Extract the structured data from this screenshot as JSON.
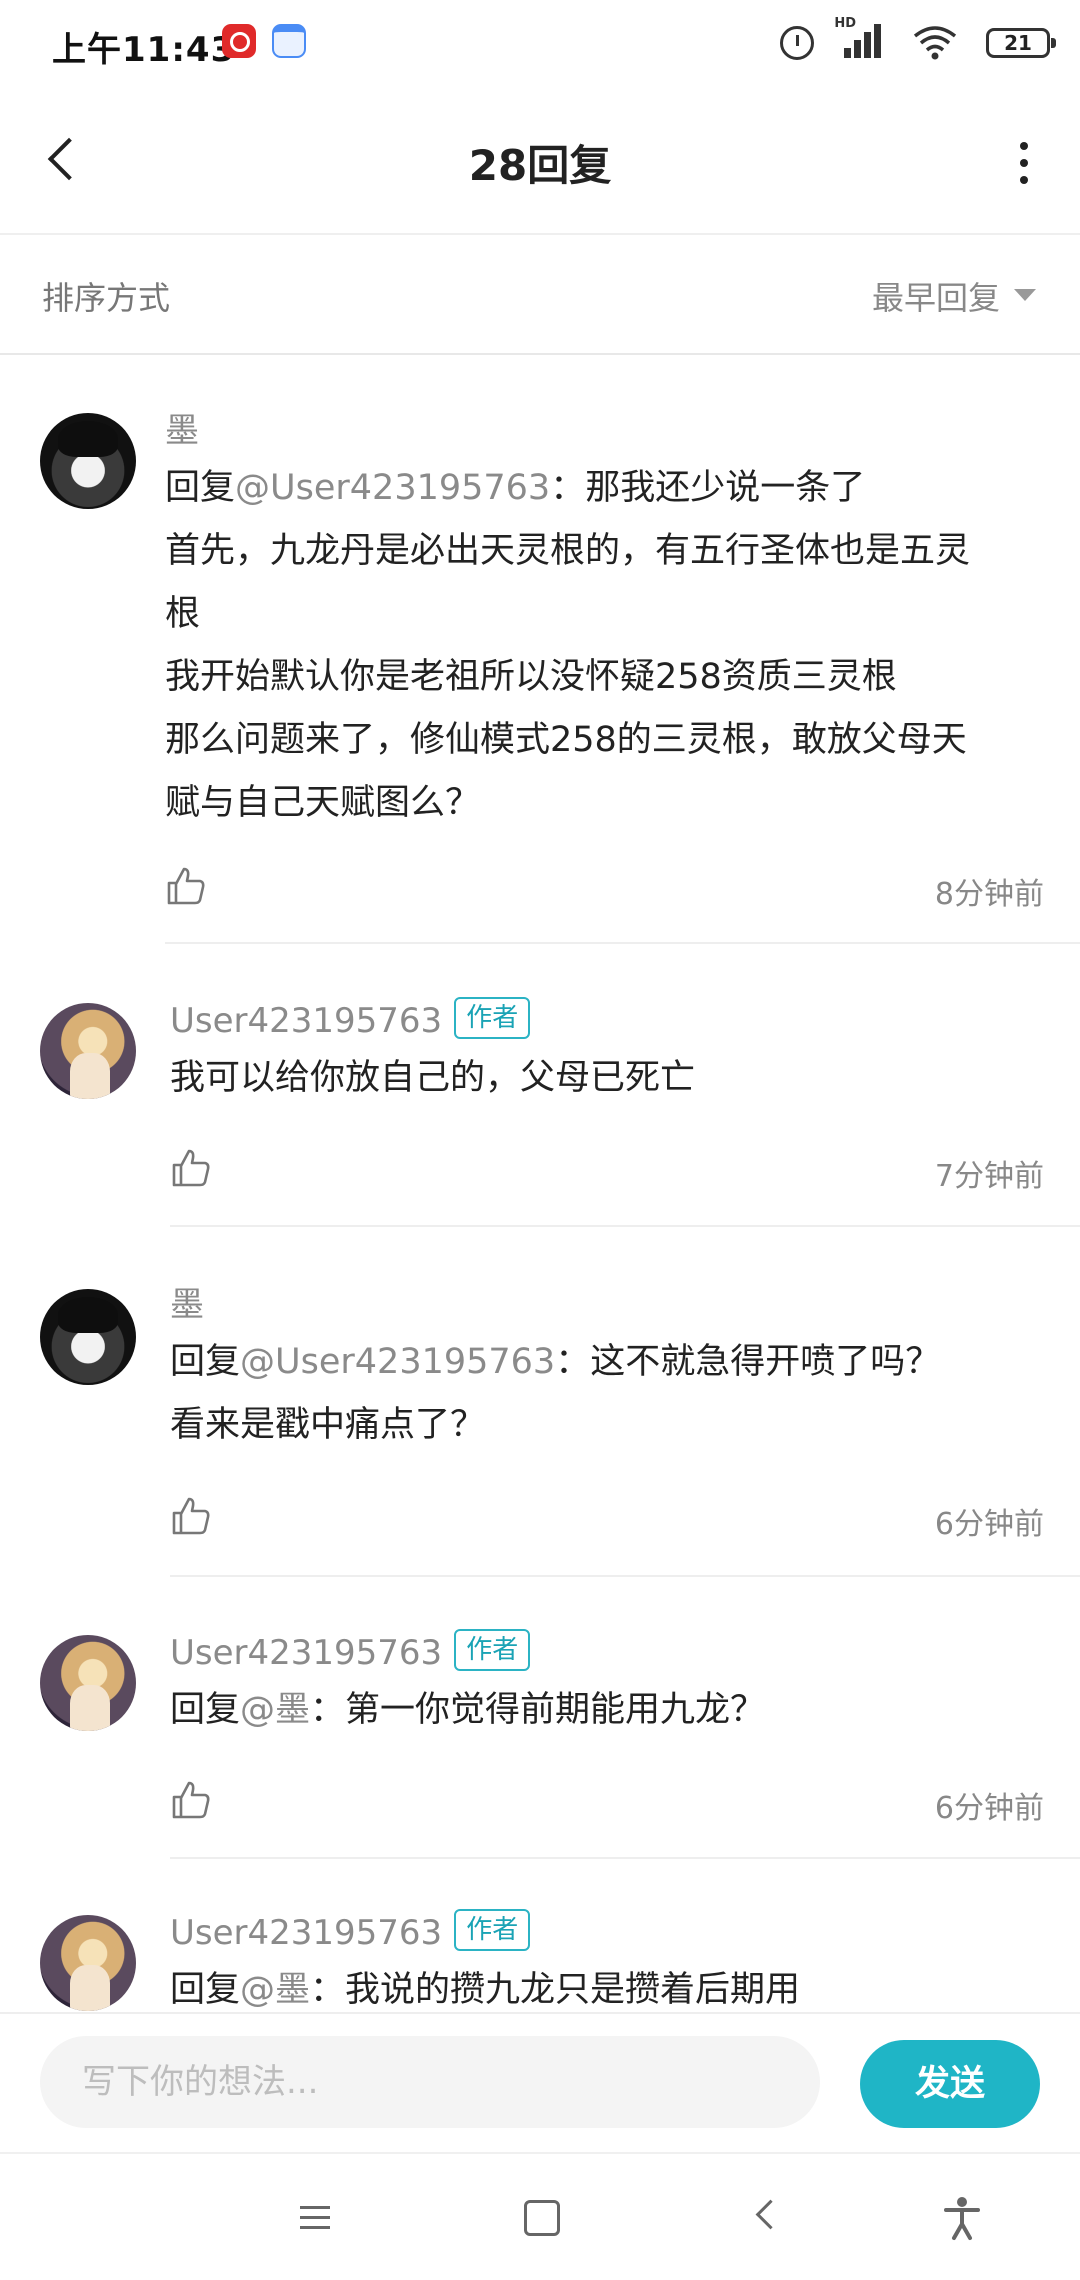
{
  "status_bar": {
    "time": "上午11:43",
    "hd_label": "HD",
    "battery": "21"
  },
  "header": {
    "title": "28回复"
  },
  "sort": {
    "label": "排序方式",
    "value": "最早回复"
  },
  "comments": [
    {
      "name": "墨",
      "author_badge": "",
      "reply_prefix": "回复",
      "mention": "@User423195763",
      "lines": [
        "：那我还少说一条了",
        "首先，九龙丹是必出天灵根的，有五行圣体也是五灵",
        "根",
        "我开始默认你是老祖所以没怀疑258资质三灵根",
        "那么问题来了，修仙模式258的三灵根，敢放父母天",
        "赋与自己天赋图么？"
      ],
      "time": "8分钟前"
    },
    {
      "name": "User423195763",
      "author_badge": "作者",
      "lines": [
        "我可以给你放自己的，父母已死亡"
      ],
      "time": "7分钟前"
    },
    {
      "name": "墨",
      "author_badge": "",
      "reply_prefix": "回复",
      "mention": "@User423195763",
      "lines": [
        "：这不就急得开喷了吗？",
        "看来是戳中痛点了？"
      ],
      "time": "6分钟前"
    },
    {
      "name": "User423195763",
      "author_badge": "作者",
      "reply_prefix": "回复",
      "mention": "@墨",
      "lines": [
        "：第一你觉得前期能用九龙？"
      ],
      "time": "6分钟前"
    },
    {
      "name": "User423195763",
      "author_badge": "作者",
      "reply_prefix": "回复",
      "mention": "@墨",
      "lines": [
        "：我说的攒九龙只是攒着后期用"
      ],
      "time": ""
    }
  ],
  "input": {
    "placeholder": "写下你的想法...",
    "send_label": "发送"
  },
  "colors": {
    "accent": "#1fb5c6",
    "muted_text": "#8a8a8a"
  }
}
